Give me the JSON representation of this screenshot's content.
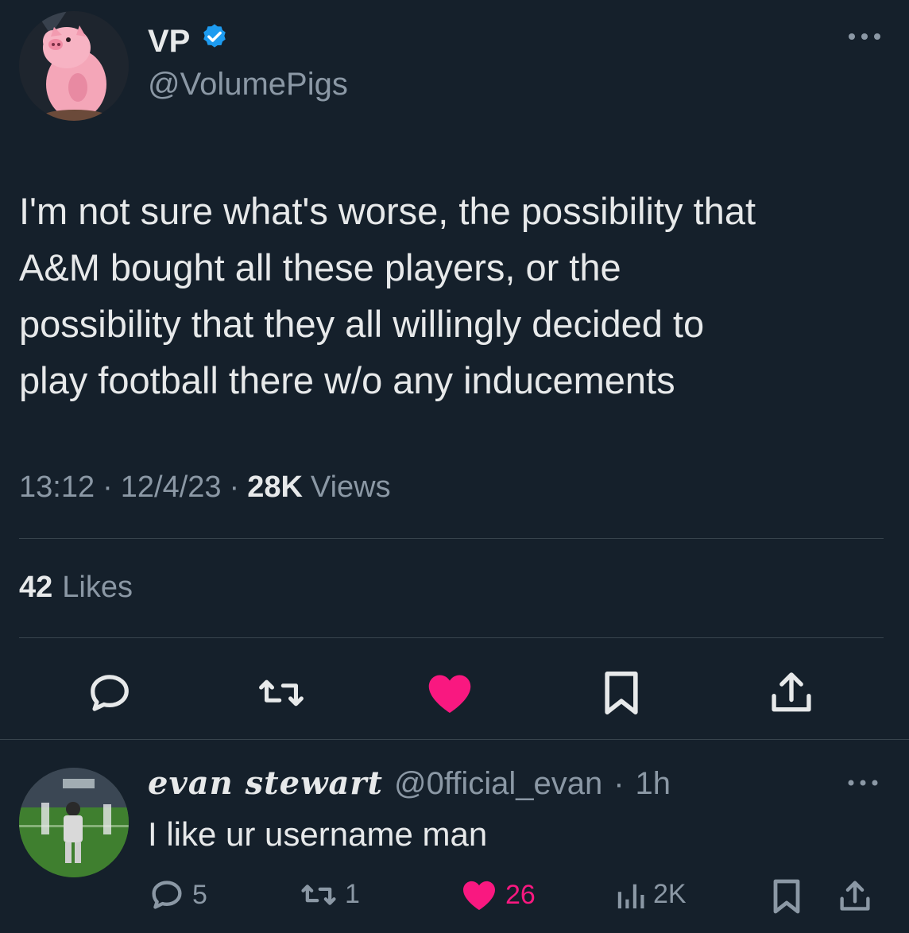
{
  "tweet": {
    "display_name": "VP",
    "handle": "@VolumePigs",
    "text": "I'm not sure what's worse, the possibility that\nA&M bought all these players, or the\npossibility that they all willingly decided to\nplay football there w/o any inducements",
    "time": "13:12",
    "date": "12/4/23",
    "views_count": "28K",
    "views_label": "Views",
    "likes_count": "42",
    "likes_label": "Likes",
    "separator": "·",
    "actions": {
      "reply_icon": "reply-icon",
      "retweet_icon": "retweet-icon",
      "like_icon": "heart-icon",
      "bookmark_icon": "bookmark-icon",
      "share_icon": "share-icon"
    }
  },
  "reply": {
    "display_name": "evan stewart",
    "handle": "@0fficial_evan",
    "separator": "·",
    "time": "1h",
    "text": "I like ur username man",
    "replies": "5",
    "retweets": "1",
    "likes": "26",
    "views": "2K"
  },
  "colors": {
    "background": "#15202b",
    "text": "#e7e9ea",
    "muted": "#8b98a5",
    "like": "#f91880",
    "verified": "#1d9bf0",
    "divider": "#38444d"
  }
}
